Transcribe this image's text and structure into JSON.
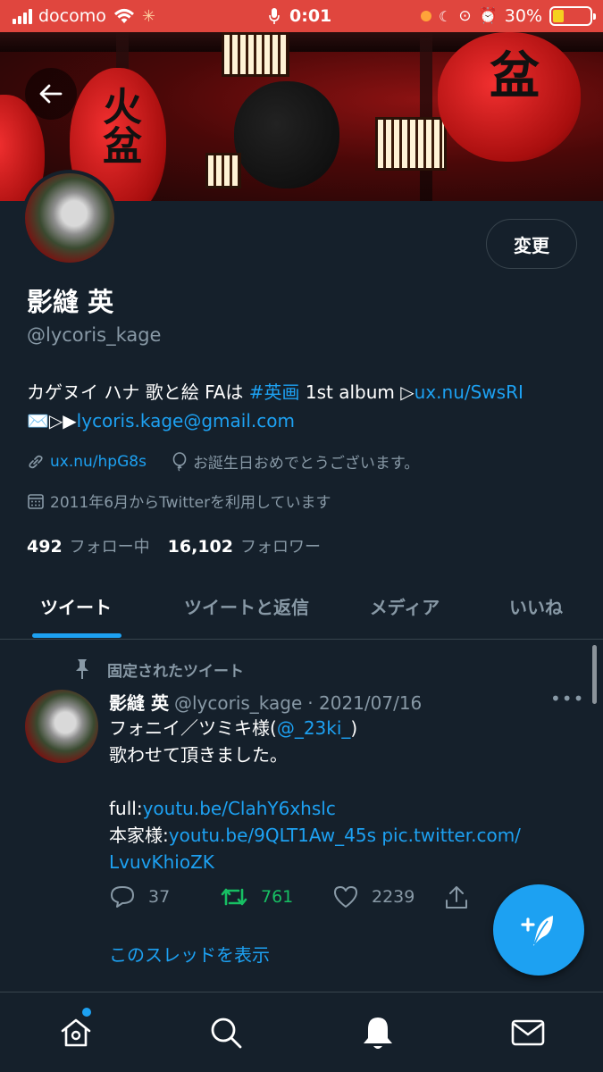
{
  "status_bar": {
    "carrier": "docomo",
    "time": "0:01",
    "battery": "30%",
    "battery_level": 0.3,
    "battery_color": "#f5d020"
  },
  "header": {
    "back_icon": "arrow-left-icon"
  },
  "profile": {
    "name": "影縫 英",
    "handle": "@lycoris_kage",
    "edit_label": "変更",
    "bio_text_1": "カゲヌイ ハナ 歌と絵 FAは ",
    "bio_hashtag": "#英画",
    "bio_text_2": " 1st album ▷",
    "bio_link_1": "ux.nu/SwsRI",
    "bio_text_3": "✉️▷▶",
    "bio_email": "lycoris.kage@gmail.com",
    "website": "ux.nu/hpG8s",
    "birthday": "お誕生日おめでとうございます。",
    "joined": "2011年6月からTwitterを利用しています",
    "following_count": "492",
    "following_label": "フォロー中",
    "followers_count": "16,102",
    "followers_label": "フォロワー"
  },
  "tabs": [
    {
      "label": "ツイート"
    },
    {
      "label": "ツイートと返信"
    },
    {
      "label": "メディア"
    },
    {
      "label": "いいね"
    }
  ],
  "tweet": {
    "pinned_label": "固定されたツイート",
    "author": "影縫 英",
    "handle": "@lycoris_kage",
    "date": "· 2021/07/16",
    "more": "•••",
    "line1_a": "フォニイ／ツミキ様(",
    "line1_mention": "@_23ki_",
    "line1_b": ")",
    "line2": "歌わせて頂きました。",
    "line3_a": "full:",
    "line3_link": "youtu.be/ClahY6xhslc",
    "line4_a": "本家様:",
    "line4_link": "youtu.be/9QLT1Aw_45s pic.twitter.com/",
    "line5_link": "LvuvKhioZK",
    "replies": "37",
    "retweets": "761",
    "likes": "2239",
    "show_thread": "このスレッドを表示"
  },
  "colors": {
    "background": "#15202b",
    "accent": "#1da1f2",
    "retweet": "#17bf63",
    "status_bar": "#e0463e"
  },
  "bottom_nav": [
    {
      "icon": "home-icon"
    },
    {
      "icon": "search-icon"
    },
    {
      "icon": "notifications-bell-icon"
    },
    {
      "icon": "messages-envelope-icon"
    }
  ]
}
